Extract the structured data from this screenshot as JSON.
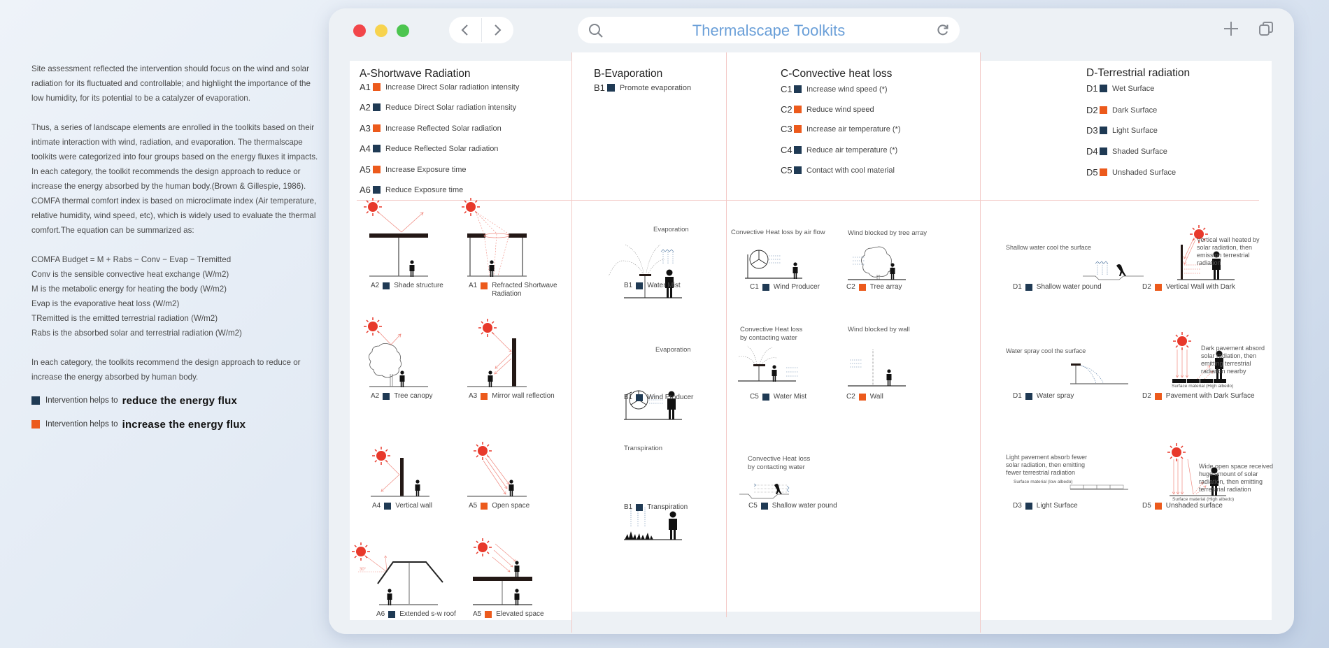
{
  "intro": {
    "p1": "Site assessment reflected the intervention should focus on the wind and solar radiation for its fluctuated and controllable; and highlight the importance of the low humidity, for its potential to be a catalyzer of evaporation.",
    "p2": "Thus, a series of landscape elements are enrolled in the toolkits based on their intimate interaction with wind, radiation, and evaporation. The thermalscape toolkits were categorized into four groups based on the energy fluxes it impacts. In each category, the toolkit recommends the design approach to reduce or increase the energy absorbed by the human body.(Brown & Gillespie, 1986). COMFA thermal comfort index is based on microclimate index (Air temperature, relative humidity, wind speed, etc), which is widely used to evaluate the thermal comfort.The equation can be summarized as:",
    "equation": [
      "COMFA Budget = M + Rabs − Conv − Evap − Tremitted",
      "Conv is the sensible convective heat exchange (W/m2)",
      "M is the metabolic energy for heating the body (W/m2)",
      "Evap is the evaporative heat loss (W/m2)",
      "TRemitted is the emitted terrestrial radiation (W/m2)",
      "Rabs is the absorbed solar and terrestrial radiation (W/m2)"
    ],
    "p3": "In each category, the toolkits recommend the design approach to reduce or increase the energy absorbed by human body.",
    "legend": [
      {
        "prefix": "Intervention helps to",
        "emphasis": "reduce the energy flux",
        "color": "#1f3a54"
      },
      {
        "prefix": "Intervention helps to",
        "emphasis": "increase the energy flux",
        "color": "#ec5a1c"
      }
    ]
  },
  "colors": {
    "reduce": "#1f3a54",
    "increase": "#ec5a1c",
    "sun": "#e8392b",
    "ray": "#f08a80",
    "air": "#5b7fa6",
    "title": "#6a9fd8",
    "divider": "#f3c9c6"
  },
  "window": {
    "title": "Thermalscape Toolkits",
    "icons": {
      "back": "chevron-left-icon",
      "forward": "chevron-right-icon",
      "search": "search-icon",
      "reload": "reload-icon",
      "new_tab": "plus-icon",
      "tabs": "tabs-icon"
    }
  },
  "columns": [
    {
      "title": "A-Shortwave Radiation",
      "items": [
        {
          "code": "A1",
          "type": "increase",
          "label": "Increase Direct Solar radiation intensity"
        },
        {
          "code": "A2",
          "type": "reduce",
          "label": "Reduce Direct Solar radiation intensity"
        },
        {
          "code": "A3",
          "type": "increase",
          "label": "Increase Reflected Solar radiation"
        },
        {
          "code": "A4",
          "type": "reduce",
          "label": "Reduce Reflected Solar radiation"
        },
        {
          "code": "A5",
          "type": "increase",
          "label": "Increase Exposure time"
        },
        {
          "code": "A6",
          "type": "reduce",
          "label": "Reduce Exposure time"
        }
      ],
      "figures": [
        {
          "code": "A2",
          "type": "reduce",
          "label": "Shade structure"
        },
        {
          "code": "A1",
          "type": "increase",
          "label": "Refracted Shortwave",
          "label2": "Radiation"
        },
        {
          "code": "A2",
          "type": "reduce",
          "label": "Tree canopy"
        },
        {
          "code": "A3",
          "type": "increase",
          "label": "Mirror wall reflection"
        },
        {
          "code": "A4",
          "type": "reduce",
          "label": "Vertical wall"
        },
        {
          "code": "A5",
          "type": "increase",
          "label": "Open space"
        },
        {
          "code": "A6",
          "type": "reduce",
          "label": "Extended s-w roof",
          "angle": "30°"
        },
        {
          "code": "A5",
          "type": "increase",
          "label": "Elevated space"
        }
      ]
    },
    {
      "title": "B-Evaporation",
      "items": [
        {
          "code": "B1",
          "type": "reduce",
          "label": "Promote evaporation"
        }
      ],
      "figures": [
        {
          "code": "B1",
          "type": "reduce",
          "label": "Water Mist",
          "note": "Evaporation"
        },
        {
          "code": "B1",
          "type": "reduce",
          "label": "Wind Producer",
          "note": "Evaporation"
        },
        {
          "code": "B1",
          "type": "reduce",
          "label": "Transpiration",
          "note": "Transpiration"
        }
      ]
    },
    {
      "title": "C-Convective heat loss",
      "items": [
        {
          "code": "C1",
          "type": "reduce",
          "label": "Increase wind speed (*)"
        },
        {
          "code": "C2",
          "type": "increase",
          "label": "Reduce wind speed"
        },
        {
          "code": "C3",
          "type": "increase",
          "label": "Increase air temperature (*)"
        },
        {
          "code": "C4",
          "type": "reduce",
          "label": "Reduce air temperature (*)"
        },
        {
          "code": "C5",
          "type": "reduce",
          "label": "Contact with cool material"
        }
      ],
      "figures": [
        {
          "code": "C1",
          "type": "reduce",
          "label": "Wind Producer",
          "note": "Convective Heat loss by air flow"
        },
        {
          "code": "C2",
          "type": "increase",
          "label": "Tree array",
          "note": "Wind blocked by tree array"
        },
        {
          "code": "C5",
          "type": "reduce",
          "label": "Water Mist",
          "note": "Convective Heat loss",
          "note2": "by contacting water"
        },
        {
          "code": "C2",
          "type": "increase",
          "label": "Wall",
          "note": "Wind blocked by wall"
        },
        {
          "code": "C5",
          "type": "reduce",
          "label": "Shallow water pound",
          "note": "Convective Heat loss",
          "note2": "by contacting water"
        }
      ]
    },
    {
      "title": "D-Terrestrial radiation",
      "items": [
        {
          "code": "D1",
          "type": "reduce",
          "label": "Wet Surface"
        },
        {
          "code": "D2",
          "type": "increase",
          "label": "Dark Surface"
        },
        {
          "code": "D3",
          "type": "reduce",
          "label": "Light Surface"
        },
        {
          "code": "D4",
          "type": "reduce",
          "label": "Shaded Surface"
        },
        {
          "code": "D5",
          "type": "increase",
          "label": "Unshaded Surface"
        }
      ],
      "figures": [
        {
          "code": "D1",
          "type": "reduce",
          "label": "Shallow water pound",
          "note": "Shallow water cool the surface"
        },
        {
          "code": "D2",
          "type": "increase",
          "label": "Vertical Wall with Dark",
          "note": "Vertical wall heated by solar radiation, then emission terrestrial radiation"
        },
        {
          "code": "D1",
          "type": "reduce",
          "label": "Water spray",
          "note": "Water spray cool the surface"
        },
        {
          "code": "D2",
          "type": "increase",
          "label": "Pavement with Dark Surface",
          "note": "Dark pavement absord solar radiation, then emitting terrestrial radiation nearby",
          "sub": "Surface material (High albedo)"
        },
        {
          "code": "D3",
          "type": "reduce",
          "label": "Light Surface",
          "note": "Light pavement absorb fewer solar radiation, then emitting fewer terrestrial radiation",
          "sub": "Surface material (low albedo)"
        },
        {
          "code": "D5",
          "type": "increase",
          "label": "Unshaded surface",
          "note": "Wide open space received huge amount of solar radiation, then emitting terrestrial radiation",
          "sub": "Surface material (High albedo)"
        }
      ]
    }
  ]
}
